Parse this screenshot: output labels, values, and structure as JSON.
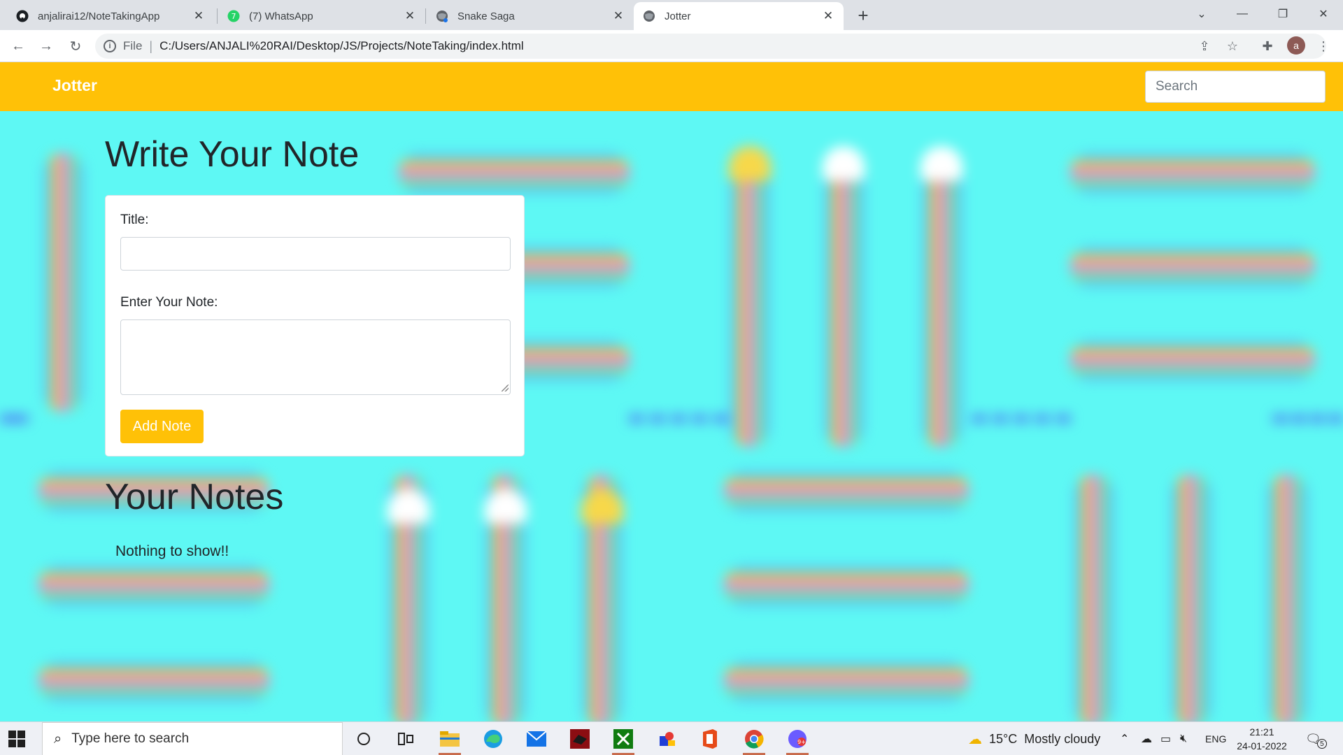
{
  "browser": {
    "tabs": [
      {
        "title": "anjalirai12/NoteTakingApp",
        "icon": "github-icon"
      },
      {
        "title": "(7) WhatsApp",
        "icon": "whatsapp-icon"
      },
      {
        "title": "Snake Saga",
        "icon": "globe-icon"
      },
      {
        "title": "Jotter",
        "icon": "globe-icon",
        "active": true
      }
    ],
    "address": {
      "scheme_label": "File",
      "url": "C:/Users/ANJALI%20RAI/Desktop/JS/Projects/NoteTaking/index.html"
    },
    "profile_initial": "a"
  },
  "site": {
    "brand": "Jotter",
    "search_placeholder": "Search",
    "write_heading": "Write Your Note",
    "title_label": "Title:",
    "title_value": "",
    "note_label": "Enter Your Note:",
    "note_value": "",
    "add_button": "Add Note",
    "notes_heading": "Your Notes",
    "empty_message": "Nothing to show!!",
    "colors": {
      "accent": "#ffc107",
      "background": "#5ef8f4"
    }
  },
  "taskbar": {
    "search_placeholder": "Type here to search",
    "weather": "15°C  Mostly cloudy",
    "language": "ENG",
    "time": "21:21",
    "date": "24-01-2022",
    "notification_count": "5"
  }
}
